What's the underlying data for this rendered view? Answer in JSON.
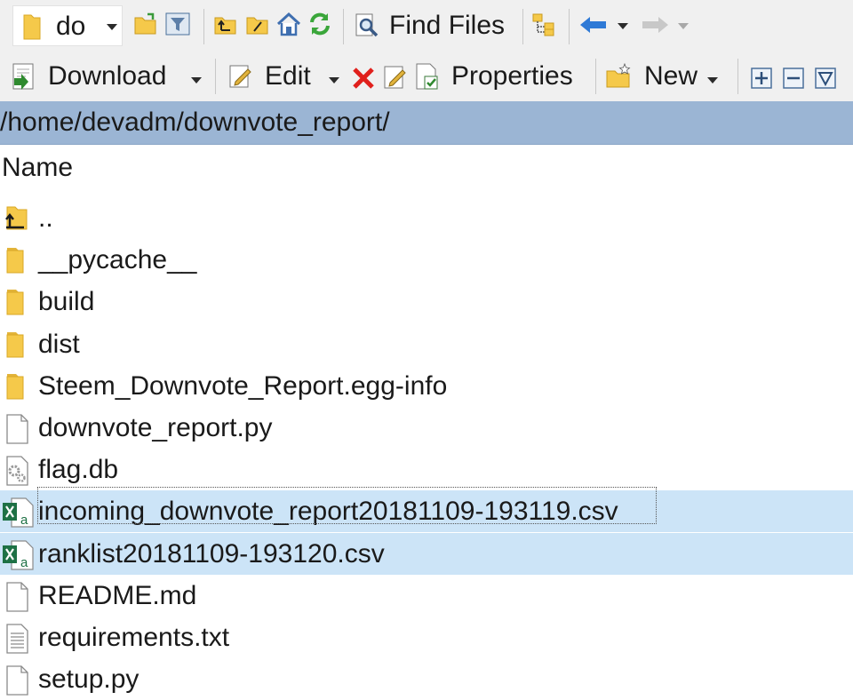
{
  "toolbar_top": {
    "drive_label": "do",
    "find_files_label": "Find Files"
  },
  "toolbar_main": {
    "download_label": "Download",
    "edit_label": "Edit",
    "properties_label": "Properties",
    "new_label": "New"
  },
  "path": "/home/devadm/downvote_report/",
  "list": {
    "column_name": "Name",
    "items": [
      {
        "name": "..",
        "icon": "parent-dir-icon"
      },
      {
        "name": "__pycache__",
        "icon": "folder-icon"
      },
      {
        "name": "build",
        "icon": "folder-icon"
      },
      {
        "name": "dist",
        "icon": "folder-icon"
      },
      {
        "name": "Steem_Downvote_Report.egg-info",
        "icon": "folder-icon"
      },
      {
        "name": "downvote_report.py",
        "icon": "file-icon"
      },
      {
        "name": "flag.db",
        "icon": "settings-file-icon"
      },
      {
        "name": "incoming_downvote_report20181109-193119.csv",
        "icon": "excel-csv-icon",
        "selected": true
      },
      {
        "name": "ranklist20181109-193120.csv",
        "icon": "excel-csv-icon",
        "selected": true
      },
      {
        "name": "README.md",
        "icon": "file-icon"
      },
      {
        "name": "requirements.txt",
        "icon": "text-file-icon"
      },
      {
        "name": "setup.py",
        "icon": "file-icon"
      }
    ]
  },
  "colors": {
    "path_bar": "#9bb5d4",
    "selection": "#cce4f7",
    "folder": "#f5c94a",
    "excel_green": "#1e7145"
  }
}
